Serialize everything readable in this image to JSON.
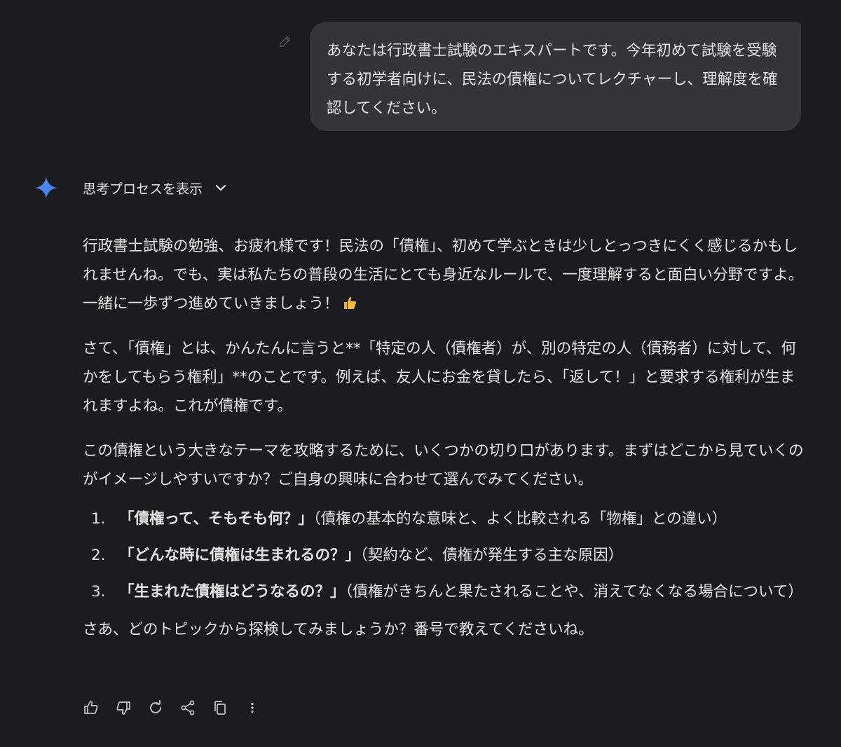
{
  "user_message": {
    "text": "あなたは行政書士試験のエキスパートです。今年初めて試験を受験する初学者向けに、民法の債権についてレクチャーし、理解度を確認してください。"
  },
  "response": {
    "thinking_toggle_label": "思考プロセスを表示",
    "paragraph1": "行政書士試験の勉強、お疲れ様です！民法の「債権」、初めて学ぶときは少しとっつきにくく感じるかもしれませんね。でも、実は私たちの普段の生活にとても身近なルールで、一度理解すると面白い分野ですよ。一緒に一歩ずつ進めていきましょう！",
    "paragraph2": "さて、「債権」とは、かんたんに言うと**「特定の人（債権者）が、別の特定の人（債務者）に対して、何かをしてもらう権利」**のことです。例えば、友人にお金を貸したら、「返して！」と要求する権利が生まれますよね。これが債権です。",
    "paragraph3": "この債権という大きなテーマを攻略するために、いくつかの切り口があります。まずはどこから見ていくのがイメージしやすいですか？ご自身の興味に合わせて選んでみてください。",
    "topics": [
      {
        "number": "1.",
        "title": "「債権って、そもそも何？」",
        "desc": "（債権の基本的な意味と、よく比較される「物権」との違い）"
      },
      {
        "number": "2.",
        "title": "「どんな時に債権は生まれるの？」",
        "desc": "（契約など、債権が発生する主な原因）"
      },
      {
        "number": "3.",
        "title": "「生まれた債権はどうなるの？」",
        "desc": "（債権がきちんと果たされることや、消えてなくなる場合について）"
      }
    ],
    "closing": "さあ、どのトピックから探検してみましょうか？番号で教えてくださいね。"
  },
  "icons": {
    "edit": "pencil-icon",
    "gem": "sparkle-icon",
    "thinking_chevron": "chevron-down-icon",
    "emoji": "thumbs-up-emoji",
    "actions": [
      "thumbs-up-icon",
      "thumbs-down-icon",
      "regenerate-icon",
      "share-icon",
      "copy-icon",
      "more-vertical-icon"
    ]
  },
  "colors": {
    "background": "#1b1c1d",
    "bubble": "#333537",
    "text": "#e3e3e3",
    "gem_blue": "#4c8df6"
  }
}
